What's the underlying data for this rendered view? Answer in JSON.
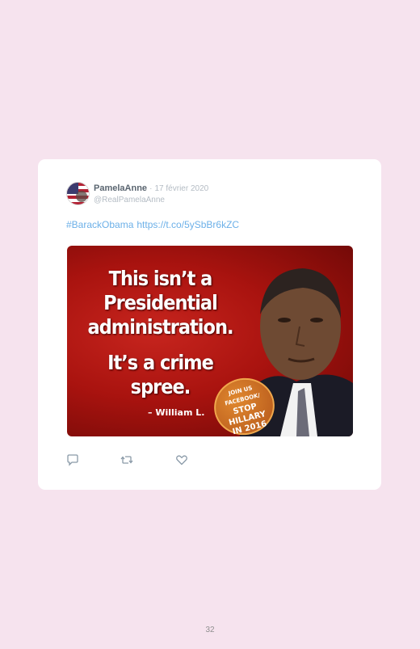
{
  "tweet": {
    "display_name": "PamelaAnne",
    "separator": "·",
    "date": "17 février 2020",
    "handle": "@RealPamelaAnne",
    "hashtag": "#BarackObama",
    "link": "https://t.co/5ySbBr6kZC",
    "media": {
      "quote_line1": "This isn’t a",
      "quote_line2": "Presidential",
      "quote_line3": "administration.",
      "quote_line4": "It’s a crime",
      "quote_line5": "spree.",
      "author": "– William L.",
      "badge_line1": "JOIN US",
      "badge_line2": "FACEBOOK/",
      "badge_line3": "STOP",
      "badge_line4": "HILLARY",
      "badge_line5": "IN 2016"
    },
    "actions": {
      "reply_icon": "reply-icon",
      "retweet_icon": "retweet-icon",
      "like_icon": "heart-icon"
    }
  },
  "page_number": "32",
  "colors": {
    "page_background": "#f6e3ee",
    "card": "#ffffff",
    "link": "#6cb0e8",
    "meta": "#b4bcc4"
  }
}
